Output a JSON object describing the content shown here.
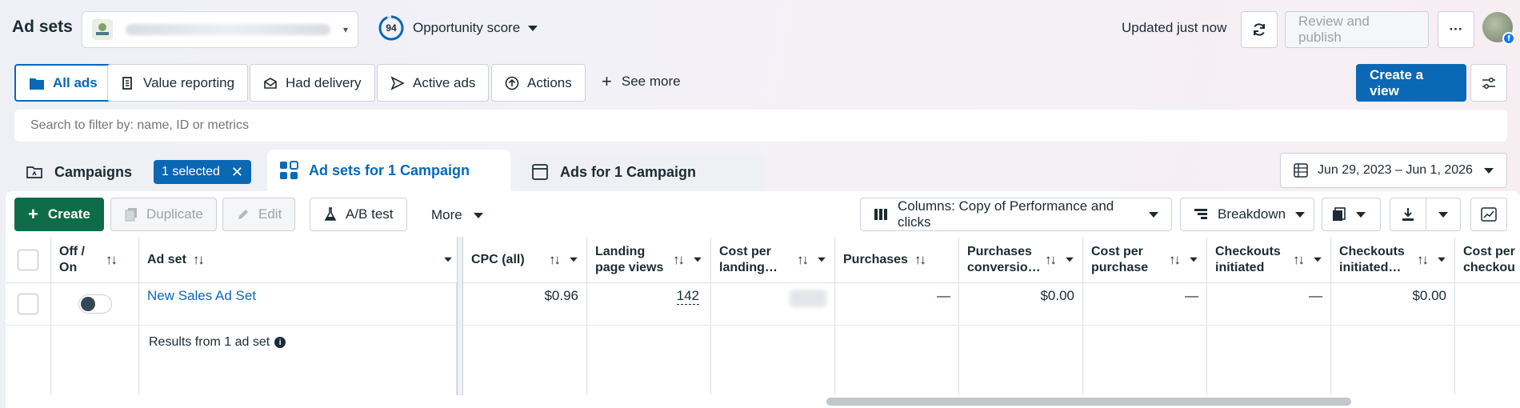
{
  "header": {
    "title": "Ad sets",
    "opportunity_score": "94",
    "opportunity_label": "Opportunity score",
    "updated": "Updated just now",
    "review_publish": "Review and publish",
    "more": "···"
  },
  "filters": {
    "all_ads": "All ads",
    "value_reporting": "Value reporting",
    "had_delivery": "Had delivery",
    "active_ads": "Active ads",
    "actions": "Actions",
    "see_more": "See more",
    "create_view": "Create a view"
  },
  "search": {
    "placeholder": "Search to filter by: name, ID or metrics"
  },
  "tabs": {
    "campaigns": "Campaigns",
    "selected_badge": "1 selected",
    "adsets": "Ad sets for 1 Campaign",
    "ads": "Ads for 1 Campaign",
    "date_range": "Jun 29, 2023 – Jun 1, 2026"
  },
  "toolbar": {
    "create": "Create",
    "duplicate": "Duplicate",
    "edit": "Edit",
    "ab_test": "A/B test",
    "more": "More",
    "columns": "Columns: Copy of Performance and clicks",
    "breakdown": "Breakdown"
  },
  "table": {
    "headers": {
      "off_on": [
        "Off /",
        "On"
      ],
      "ad_set": "Ad set",
      "cpc": "CPC (all)",
      "landing_views": [
        "Landing",
        "page views"
      ],
      "cost_landing": [
        "Cost per",
        "landing…"
      ],
      "purchases": "Purchases",
      "purchases_conv": [
        "Purchases",
        "conversio…"
      ],
      "cost_purchase": [
        "Cost per",
        "purchase"
      ],
      "checkouts": [
        "Checkouts",
        "initiated"
      ],
      "checkouts_init": [
        "Checkouts",
        "initiated…"
      ],
      "cost_checkout": [
        "Cost per",
        "checkou"
      ]
    },
    "row": {
      "name": "New Sales Ad Set",
      "cpc": "$0.96",
      "landing_views": "142",
      "purchases": "—",
      "purchases_conv": "$0.00",
      "cost_purchase": "—",
      "checkouts": "—",
      "checkouts_init": "$0.00"
    },
    "results": "Results from 1 ad set"
  },
  "colors": {
    "accent": "#0a68b5",
    "create": "#0e6b4a"
  }
}
